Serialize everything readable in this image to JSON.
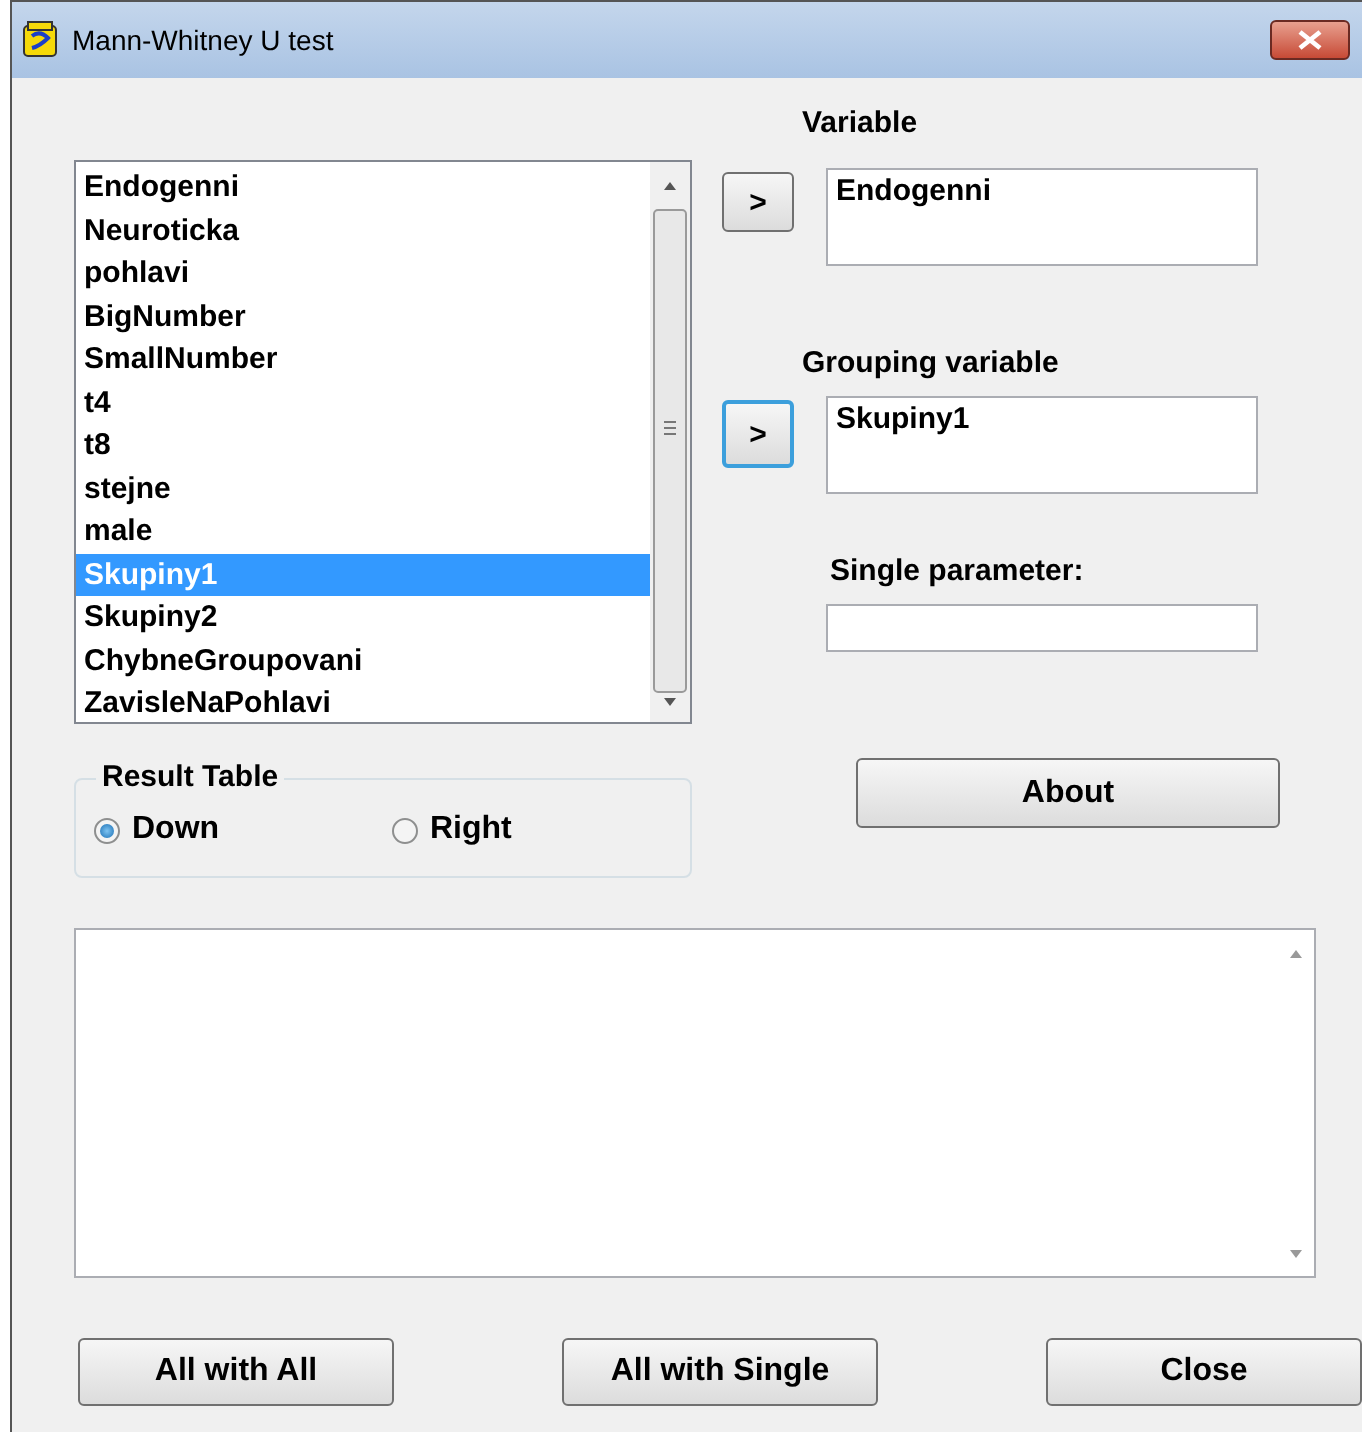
{
  "window": {
    "title": "Mann-Whitney U test"
  },
  "variable_list": {
    "items": [
      {
        "label": "Endogenni",
        "selected": false
      },
      {
        "label": "Neuroticka",
        "selected": false
      },
      {
        "label": "pohlavi",
        "selected": false
      },
      {
        "label": "BigNumber",
        "selected": false
      },
      {
        "label": "SmallNumber",
        "selected": false
      },
      {
        "label": "t4",
        "selected": false
      },
      {
        "label": "t8",
        "selected": false
      },
      {
        "label": "stejne",
        "selected": false
      },
      {
        "label": "male",
        "selected": false
      },
      {
        "label": "Skupiny1",
        "selected": true
      },
      {
        "label": "Skupiny2",
        "selected": false
      },
      {
        "label": "ChybneGroupovani",
        "selected": false
      },
      {
        "label": "ZavisleNaPohlavi",
        "selected": false
      }
    ]
  },
  "variable": {
    "label": "Variable",
    "button": ">",
    "focused": false,
    "value": "Endogenni"
  },
  "grouping_variable": {
    "label": "Grouping variable",
    "button": ">",
    "focused": true,
    "value": "Skupiny1"
  },
  "single_parameter": {
    "label": "Single parameter:"
  },
  "result_table": {
    "label": "Result Table",
    "options": [
      {
        "label": "Down",
        "selected": true
      },
      {
        "label": "Right",
        "selected": false
      }
    ]
  },
  "about_button": "About",
  "buttons": [
    "All with All",
    "All with Single",
    "Close"
  ]
}
